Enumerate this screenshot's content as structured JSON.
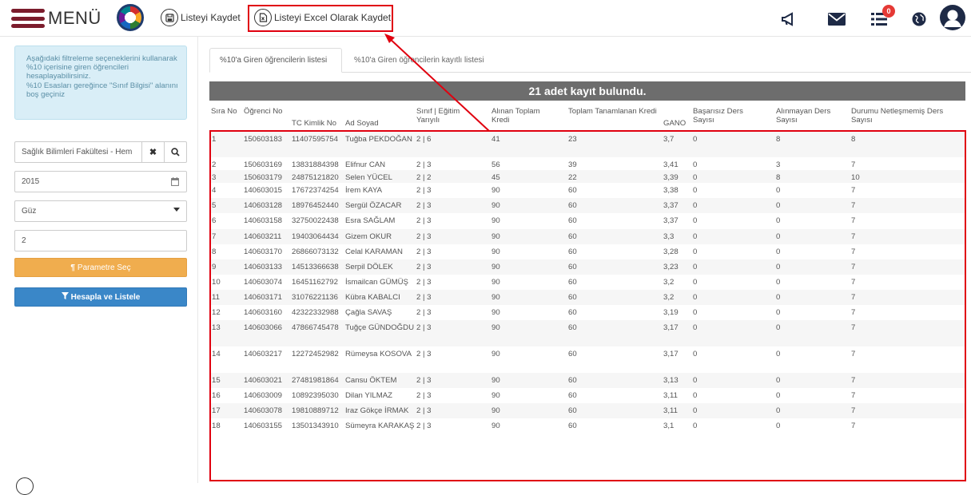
{
  "topbar": {
    "menu_label": "MENÜ",
    "save_list_label": "Listeyi Kaydet",
    "save_excel_label": "Listeyi Excel Olarak Kaydet",
    "notification_count": "0"
  },
  "sidebar": {
    "info_text": "Aşağıdaki filtreleme seçeneklerini kullanarak %10 içerisine giren öğrencileri hesaplayabilirsiniz.\n%10 Esasları gereğince \"Sınıf Bilgisi\" alanını boş geçiniz",
    "faculty_value": "Sağlık Bilimleri Fakültesi - Hem",
    "year_value": "2015",
    "term_value": "Güz",
    "class_value": "2",
    "param_button": "Parametre Seç",
    "calc_button": "Hesapla ve Listele"
  },
  "tabs": [
    {
      "label": "%10'a Giren öğrencilerin listesi"
    },
    {
      "label": "%10'a Giren öğrencilerin kayıtlı listesi"
    }
  ],
  "banner": "21 adet kayıt bulundu.",
  "table": {
    "headers": {
      "sira": "Sıra No",
      "ogrenci": "Öğrenci No",
      "tc": "TC Kimlik No",
      "ad": "Ad Soyad",
      "sinif": "Sınıf | Eğitim Yarıyılı",
      "alinan": "Alınan Toplam Kredi",
      "tanamlanan": "Toplam Tanamlanan Kredi",
      "gano": "GANO",
      "basarisiz": "Başarısız Ders Sayısı",
      "alinmayan": "Alınmayan Ders Sayısı",
      "netlesmemis": "Durumu Netleşmemiş Ders Sayısı"
    },
    "rows": [
      [
        "1",
        "150603183",
        "11407595754",
        "Tuğba PEKDOĞAN",
        "2 | 6",
        "41",
        "23",
        "3,7",
        "0",
        "8",
        "8"
      ],
      [
        "2",
        "150603169",
        "13831884398",
        "Elifnur CAN",
        "2 | 3",
        "56",
        "39",
        "3,41",
        "0",
        "3",
        "7"
      ],
      [
        "3",
        "150603179",
        "24875121820",
        "Selen YÜCEL",
        "2 | 2",
        "45",
        "22",
        "3,39",
        "0",
        "8",
        "10"
      ],
      [
        "4",
        "140603015",
        "17672374254",
        "İrem KAYA",
        "2 | 3",
        "90",
        "60",
        "3,38",
        "0",
        "0",
        "7"
      ],
      [
        "5",
        "140603128",
        "18976452440",
        "Sergül ÖZACAR",
        "2 | 3",
        "90",
        "60",
        "3,37",
        "0",
        "0",
        "7"
      ],
      [
        "6",
        "140603158",
        "32750022438",
        "Esra SAĞLAM",
        "2 | 3",
        "90",
        "60",
        "3,37",
        "0",
        "0",
        "7"
      ],
      [
        "7",
        "140603211",
        "19403064434",
        "Gizem OKUR",
        "2 | 3",
        "90",
        "60",
        "3,3",
        "0",
        "0",
        "7"
      ],
      [
        "8",
        "140603170",
        "26866073132",
        "Celal KARAMAN",
        "2 | 3",
        "90",
        "60",
        "3,28",
        "0",
        "0",
        "7"
      ],
      [
        "9",
        "140603133",
        "14513366638",
        "Serpil DÖLEK",
        "2 | 3",
        "90",
        "60",
        "3,23",
        "0",
        "0",
        "7"
      ],
      [
        "10",
        "140603074",
        "16451162792",
        "İsmailcan GÜMÜŞ",
        "2 | 3",
        "90",
        "60",
        "3,2",
        "0",
        "0",
        "7"
      ],
      [
        "11",
        "140603171",
        "31076221136",
        "Kübra KABALCI",
        "2 | 3",
        "90",
        "60",
        "3,2",
        "0",
        "0",
        "7"
      ],
      [
        "12",
        "140603160",
        "42322332988",
        "Çağla SAVAŞ",
        "2 | 3",
        "90",
        "60",
        "3,19",
        "0",
        "0",
        "7"
      ],
      [
        "13",
        "140603066",
        "47866745478",
        "Tuğçe GÜNDOĞDU",
        "2 | 3",
        "90",
        "60",
        "3,17",
        "0",
        "0",
        "7"
      ],
      [
        "14",
        "140603217",
        "12272452982",
        "Rümeysa KOSOVA",
        "2 | 3",
        "90",
        "60",
        "3,17",
        "0",
        "0",
        "7"
      ],
      [
        "15",
        "140603021",
        "27481981864",
        "Cansu ÖKTEM",
        "2 | 3",
        "90",
        "60",
        "3,13",
        "0",
        "0",
        "7"
      ],
      [
        "16",
        "140603009",
        "10892395030",
        "Dilan YILMAZ",
        "2 | 3",
        "90",
        "60",
        "3,11",
        "0",
        "0",
        "7"
      ],
      [
        "17",
        "140603078",
        "19810889712",
        "Iraz Gökçe İRMAK",
        "2 | 3",
        "90",
        "60",
        "3,11",
        "0",
        "0",
        "7"
      ],
      [
        "18",
        "140603155",
        "13501343910",
        "Sümeyra KARAKAŞ",
        "2 | 3",
        "90",
        "60",
        "3,1",
        "0",
        "0",
        "7"
      ]
    ]
  },
  "colors": {
    "brand": "#7b1c2c",
    "highlight": "#e0000f",
    "banner": "#6d6d6d",
    "param_button": "#f0ad4e",
    "calc_button": "#3a87c8"
  }
}
